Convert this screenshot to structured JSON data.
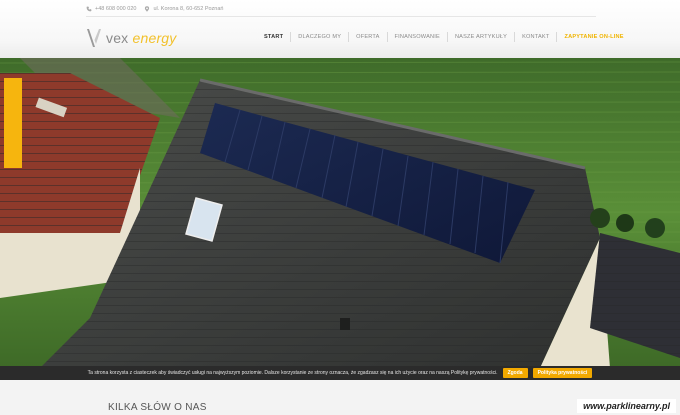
{
  "header": {
    "phone": "+48 608 000 020",
    "address": "ul. Korona 8, 60-652 Poznań",
    "logo_vex": "vex",
    "logo_energy": "energy"
  },
  "nav": {
    "items": [
      {
        "label": "START"
      },
      {
        "label": "DLACZEGO MY"
      },
      {
        "label": "OFERTA"
      },
      {
        "label": "FINANSOWANIE"
      },
      {
        "label": "NASZE ARTYKUŁY"
      },
      {
        "label": "KONTAKT"
      },
      {
        "label": "ZAPYTANIE ON-LINE"
      }
    ]
  },
  "cookie": {
    "text": "Ta strona korzysta z ciasteczek aby świadczyć usługi na najwyższym poziomie. Dalsze korzystanie ze strony oznacza, że zgadzasz się na ich użycie oraz na naszą Politykę prywatności.",
    "accept_label": "Zgoda",
    "policy_label": "Polityka prywatności"
  },
  "section": {
    "title": "KILKA SŁÓW O NAS"
  },
  "watermark": "www.parklinearny.pl",
  "colors": {
    "accent": "#f2c12b",
    "cta": "#f0b400",
    "tab": "#f6b50e"
  }
}
